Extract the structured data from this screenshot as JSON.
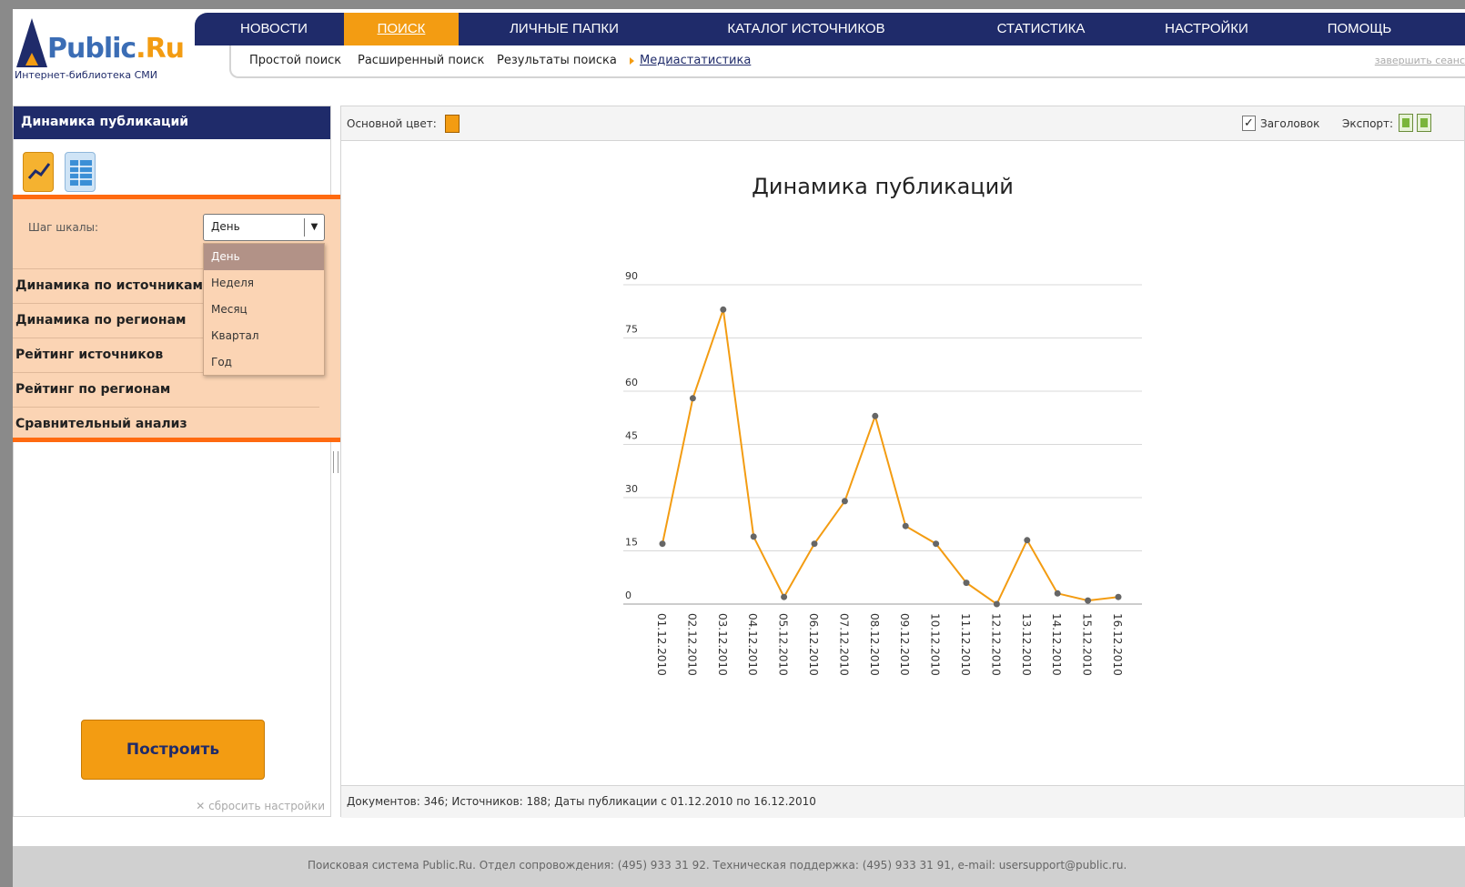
{
  "logo": {
    "name_part1": "Public",
    "name_part2": ".Ru",
    "subtitle": "Интернет-библиотека СМИ"
  },
  "topnav": [
    {
      "label": "НОВОСТИ",
      "active": false
    },
    {
      "label": "ПОИСК",
      "active": true
    },
    {
      "label": "ЛИЧНЫЕ ПАПКИ",
      "active": false
    },
    {
      "label": "КАТАЛОГ ИСТОЧНИКОВ",
      "active": false
    },
    {
      "label": "СТАТИСТИКА",
      "active": false
    },
    {
      "label": "НАСТРОЙКИ",
      "active": false
    },
    {
      "label": "ПОМОЩЬ",
      "active": false
    }
  ],
  "subnav": {
    "items": [
      "Простой поиск",
      "Расширенный поиск",
      "Результаты поиска",
      "Медиастатистика"
    ],
    "active_index": 3,
    "logout": "завершить сеанс"
  },
  "left": {
    "header": "Динамика публикаций",
    "step_label": "Шаг шкалы:",
    "step_value": "День",
    "dropdown_options": [
      "День",
      "Неделя",
      "Месяц",
      "Квартал",
      "Год"
    ],
    "menu": [
      "Динамика по источникам",
      "Динамика по регионам",
      "Рейтинг источников",
      "Рейтинг по регионам",
      "Сравнительный анализ"
    ],
    "build_button": "Построить",
    "reset_link": "сбросить настройки",
    "reset_icon": "✕"
  },
  "right": {
    "color_label": "Основной цвет:",
    "header_checkbox_label": "Заголовок",
    "header_checked": true,
    "export_label": "Экспорт:",
    "status": "Документов: 346; Источников: 188; Даты публикации с 01.12.2010 по 16.12.2010"
  },
  "colors": {
    "navy": "#1f2b6a",
    "orange": "#f39c12",
    "highlight": "#ff6a10"
  },
  "chart_data": {
    "type": "line",
    "title": "Динамика публикаций",
    "x": [
      "01.12.2010",
      "02.12.2010",
      "03.12.2010",
      "04.12.2010",
      "05.12.2010",
      "06.12.2010",
      "07.12.2010",
      "08.12.2010",
      "09.12.2010",
      "10.12.2010",
      "11.12.2010",
      "12.12.2010",
      "13.12.2010",
      "14.12.2010",
      "15.12.2010",
      "16.12.2010"
    ],
    "values": [
      17,
      58,
      83,
      19,
      2,
      17,
      29,
      53,
      22,
      17,
      6,
      0,
      18,
      3,
      1,
      2
    ],
    "yticks": [
      0,
      15,
      30,
      45,
      60,
      75,
      90
    ],
    "ylim": [
      0,
      90
    ],
    "grid": true,
    "legend": "none"
  },
  "footer": "Поисковая система Public.Ru. Отдел сопровождения: (495) 933 31 92. Техническая поддержка: (495) 933 31 91, e-mail: usersupport@public.ru."
}
